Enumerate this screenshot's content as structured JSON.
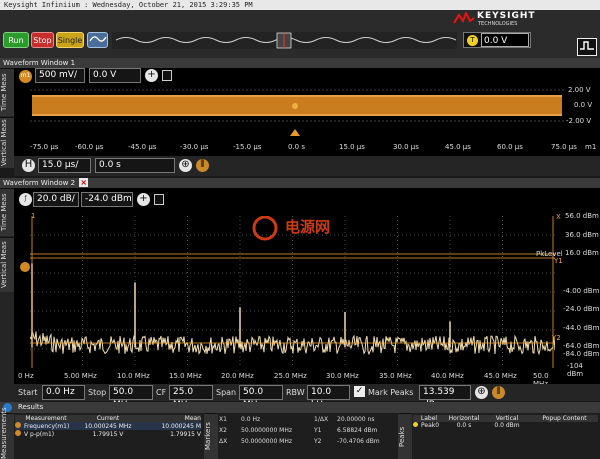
{
  "titlebar": {
    "text": "Keysight Infiniium : Wednesday, October 21, 2015 3:29:35 PM"
  },
  "toolbar": {
    "run": "Run",
    "stop": "Stop",
    "single": "Single",
    "trigger_tag": "T",
    "trigger_level": "0.0 V"
  },
  "brand": {
    "name": "KEYSIGHT",
    "sub": "TECHNOLOGIES"
  },
  "waveform1": {
    "title": "Waveform Window 1",
    "tabs": [
      "Time Meas",
      "Vertical Meas"
    ],
    "channel": "m1",
    "scale": "500 mV/",
    "offset": "0.0 V",
    "y_labels": [
      "2.00 V",
      "0.0 V",
      "-2.00 V"
    ],
    "x_labels": [
      "-75.0 µs",
      "-60.0 µs",
      "-45.0 µs",
      "-30.0 µs",
      "-15.0 µs",
      "0.0 s",
      "15.0 µs",
      "30.0 µs",
      "45.0 µs",
      "60.0 µs",
      "75.0 µs"
    ],
    "x_unit": "m1",
    "horizontal_tag": "H",
    "timebase": "15.0 µs/",
    "position": "0.0 s"
  },
  "waveform2": {
    "title": "Waveform Window 2",
    "tabs": [
      "Time Meas",
      "Vertical Meas"
    ],
    "scale": "20.0 dB/",
    "offset": "-24.0 dBm",
    "y_labels": [
      "56.0 dBm",
      "36.0 dBm",
      "16.0 dBm",
      "-4.00 dBm",
      "-24.0 dBm",
      "-44.0 dBm",
      "-64.0 dBm",
      "-84.0 dBm",
      "-104 dBm"
    ],
    "x_labels": [
      "0 Hz",
      "5.00 MHz",
      "10.0 MHz",
      "15.0 MHz",
      "20.0 MHz",
      "25.0 MHz",
      "30.0 MHz",
      "35.0 MHz",
      "40.0 MHz",
      "45.0 MHz",
      "50.0 MHz"
    ],
    "marker_labels": {
      "x": "X",
      "y1": "Y1",
      "pk_level": "PkLevel",
      "y2": "Y2",
      "one": "1"
    },
    "watermark": "电源网",
    "bottom": {
      "start_label": "Start",
      "start": "0.0 Hz",
      "stop_label": "Stop",
      "stop": "50.0 MHz",
      "cf_label": "CF",
      "cf": "25.0 MHz",
      "span_label": "Span",
      "span": "50.0 MHz",
      "rbw_label": "RBW",
      "rbw": "10.0 kHz",
      "mark_peaks_label": "Mark Peaks",
      "mark_peaks": "13.539 dBm"
    }
  },
  "results": {
    "title": "Results",
    "side_label": "Measurements",
    "headers": [
      "Measurement",
      "Current",
      "Mean"
    ],
    "rows": [
      {
        "name": "Frequency(m1)",
        "current": "10.000245 MHz",
        "mean": "10.000245 M"
      },
      {
        "name": "V p-p(m1)",
        "current": "1.79915 V",
        "mean": "1.79915 V"
      }
    ]
  },
  "markers": {
    "side_label": "Markers",
    "x1_label": "X1",
    "x1": "0.0 Hz",
    "x2_label": "X2",
    "x2": "50.0000000 MHz",
    "dx_label": "ΔX",
    "dx": "50.0000000 MHz",
    "inv_dx_label": "1/ΔX",
    "inv_dx": "20.00000 ns",
    "y1_label": "Y1",
    "y1": "6.58824 dBm",
    "y2_label": "Y2",
    "y2": "-70.4706 dBm"
  },
  "peaks": {
    "side_label": "Peaks",
    "headers": [
      "Label",
      "Horizontal",
      "Vertical",
      "Popup Content"
    ],
    "row": {
      "label": "Peak0",
      "horizontal": "0.0 s",
      "vertical": "0.0 dBm"
    }
  },
  "chart_data": {
    "type": "line",
    "xlabel": "",
    "ylabel": "",
    "x_range": [
      0,
      50
    ],
    "y_range": [
      -104,
      56
    ],
    "peaks": [
      {
        "x": 0.0,
        "y": 6.0
      },
      {
        "x": 10.0,
        "y": -14.0
      },
      {
        "x": 20.0,
        "y": -40.0
      },
      {
        "x": 30.0,
        "y": -45.0
      },
      {
        "x": 40.0,
        "y": -55.0
      }
    ],
    "noise_floor": -76,
    "colors": {
      "trace": "#f2dfae",
      "ref": "#f0a030",
      "grid": "#4a4a4a"
    }
  }
}
